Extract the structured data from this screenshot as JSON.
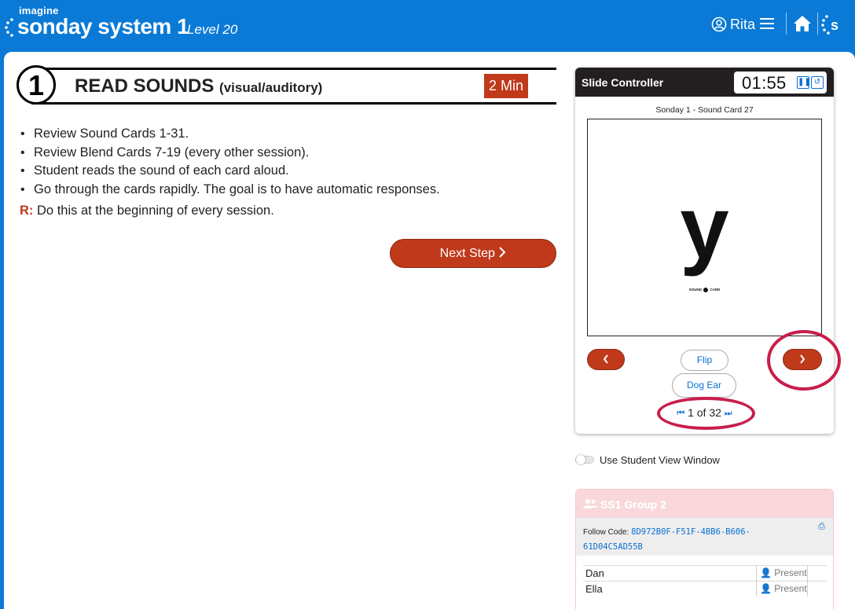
{
  "header": {
    "brand_prefix": "imagine",
    "brand_name": "sonday system 1",
    "level": "Level 20",
    "user_name": "Rita"
  },
  "step": {
    "number": "1",
    "title": "READ SOUNDS",
    "subtitle": "(visual/auditory)",
    "duration": "2 Min",
    "bullets": [
      "Review Sound Cards 1-31.",
      "Review Blend Cards 7-19 (every other session).",
      "Student reads the sound of each card aloud.",
      "Go through the cards rapidly. The goal is to have automatic responses."
    ],
    "note_label": "R:",
    "note_text": "Do this at the beginning of every session.",
    "next_label": "Next Step"
  },
  "slide_controller": {
    "title": "Slide Controller",
    "timer": "01:55",
    "card_label": "Sonday 1 - Sound Card 27",
    "card_letter": "y",
    "card_tag_left": "SOUND",
    "card_tag_num": "27",
    "card_tag_right": "CARD",
    "flip_label": "Flip",
    "dog_ear_label": "Dog Ear",
    "pager_text": "1 of 32"
  },
  "student_view": {
    "label": "Use Student View Window",
    "enabled": false
  },
  "group": {
    "name": "SS1 Group 2",
    "follow_label": "Follow Code:",
    "follow_code": "8D972B0F-F51F-4BB6-B606-61D04C5AD55B",
    "students": [
      {
        "name": "Dan",
        "status": "Present"
      },
      {
        "name": "Ella",
        "status": "Present"
      }
    ]
  },
  "colors": {
    "header_blue": "#0b7ad6",
    "accent_red": "#c0391b",
    "link_blue": "#0a6fd4",
    "highlight_circle": "#c81e4c",
    "group_header": "#f9d7db"
  }
}
